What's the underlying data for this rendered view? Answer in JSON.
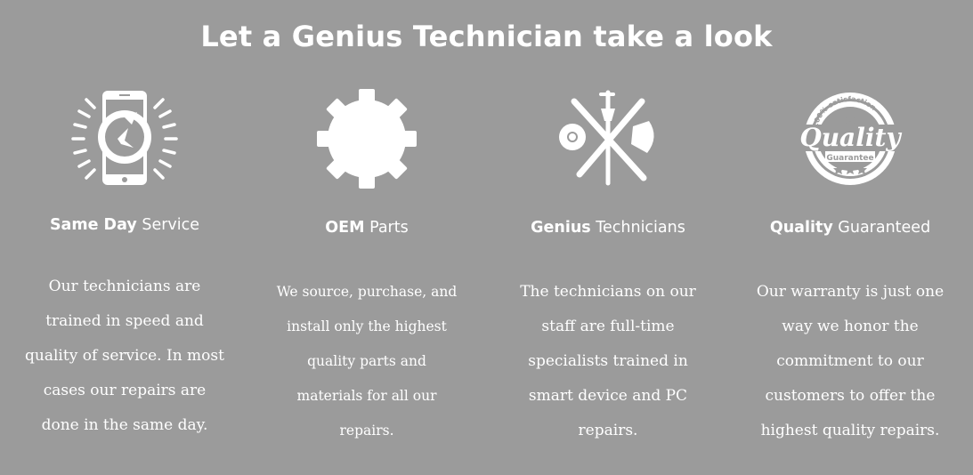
{
  "heading": "Let a Genius Technician take a look",
  "features": [
    {
      "icon": "phone-refresh-icon",
      "title_bold": "Same Day",
      "title_rest": " Service",
      "description": "Our technicians are trained in speed and quality of service. In most cases our repairs are done in the same day."
    },
    {
      "icon": "gear-icon",
      "title_bold": "OEM",
      "title_rest": " Parts",
      "description": "We source, purchase, and install only the highest quality parts and materials for all our  repairs."
    },
    {
      "icon": "repair-tools-icon",
      "title_bold": "Genius",
      "title_rest": " Technicians",
      "description": "The technicians on our staff are full-time specialists trained in smart device and PC repairs."
    },
    {
      "icon": "quality-badge-icon",
      "title_bold": "Quality",
      "title_rest": " Guaranteed",
      "description": "Our warranty is just one way we honor the commitment to our customers to offer the highest quality repairs.",
      "badge": {
        "arc_text": "100% satisfaction",
        "main_text": "Quality",
        "sub_text": "Guarantee"
      }
    }
  ]
}
